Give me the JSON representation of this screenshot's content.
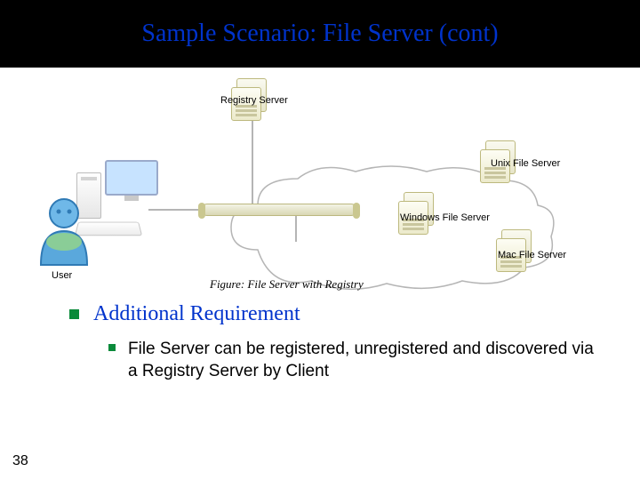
{
  "title": "Sample Scenario: File Server (cont)",
  "diagram": {
    "registry": "Registry Server",
    "unix": "Unix File Server",
    "windows": "Windows File Server",
    "mac": "Mac File Server",
    "user": "User",
    "caption": "Figure: File Server with Registry"
  },
  "section": {
    "heading": "Additional Requirement",
    "bullet1": "File Server can be registered, unregistered and discovered via a Registry Server by Client"
  },
  "slide_number": "38"
}
